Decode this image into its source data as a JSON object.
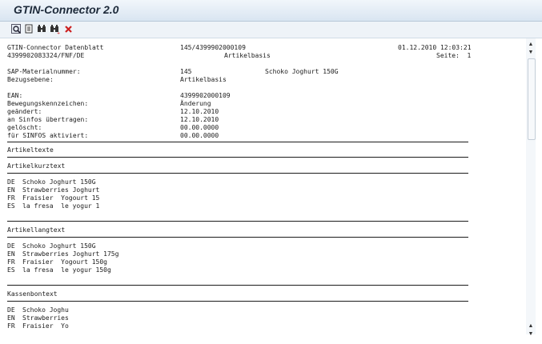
{
  "window": {
    "title": "GTIN-Connector 2.0"
  },
  "toolbar": {
    "icons": [
      "find-icon",
      "print-icon",
      "search-icon",
      "search-next-icon",
      "close-icon"
    ]
  },
  "header": {
    "line1_left": "GTIN-Connector Datenblatt",
    "line1_center": "145/4399902000109",
    "line1_right": "01.12.2010 12:03:21",
    "line2_left": "4399902083324/FNF/DE",
    "line2_center": "Artikelbasis",
    "line2_right": "Seite:  1"
  },
  "fields": [
    {
      "label": "SAP-Materialnummer:",
      "value": "145",
      "extra": "Schoko Joghurt 150G"
    },
    {
      "label": "Bezugsebene:",
      "value": "Artikelbasis",
      "extra": ""
    },
    {
      "label": "EAN:",
      "value": "4399902000109",
      "extra": ""
    },
    {
      "label": "Bewegungskennzeichen:",
      "value": "Änderung",
      "extra": ""
    },
    {
      "label": "geändert:",
      "value": "12.10.2010",
      "extra": ""
    },
    {
      "label": "an Sinfos übertragen:",
      "value": "12.10.2010",
      "extra": ""
    },
    {
      "label": "gelöscht:",
      "value": "00.00.0000",
      "extra": ""
    },
    {
      "label": "für SINFOS aktiviert:",
      "value": "00.00.0000",
      "extra": ""
    }
  ],
  "sections": {
    "artikeltexte": "Artikeltexte",
    "kurztext": {
      "title": "Artikelkurztext",
      "rows": [
        {
          "lang": "DE",
          "text": "Schoko Joghurt 150G"
        },
        {
          "lang": "EN",
          "text": "Strawberries Joghurt"
        },
        {
          "lang": "FR",
          "text": "Fraisier  Yogourt 15"
        },
        {
          "lang": "ES",
          "text": "la fresa  le yogur 1"
        }
      ]
    },
    "langtext": {
      "title": "Artikellangtext",
      "rows": [
        {
          "lang": "DE",
          "text": "Schoko Joghurt 150G"
        },
        {
          "lang": "EN",
          "text": "Strawberries Joghurt 175g"
        },
        {
          "lang": "FR",
          "text": "Fraisier  Yogourt 150g"
        },
        {
          "lang": "ES",
          "text": "la fresa  le yogur 150g"
        }
      ]
    },
    "kassenbontext": {
      "title": "Kassenbontext",
      "rows": [
        {
          "lang": "DE",
          "text": "Schoko Joghu"
        },
        {
          "lang": "EN",
          "text": "Strawberries"
        },
        {
          "lang": "FR",
          "text": "Fraisier  Yo"
        }
      ]
    }
  },
  "colors": {
    "accent": "#1d2a3a",
    "close": "#cc2020"
  }
}
